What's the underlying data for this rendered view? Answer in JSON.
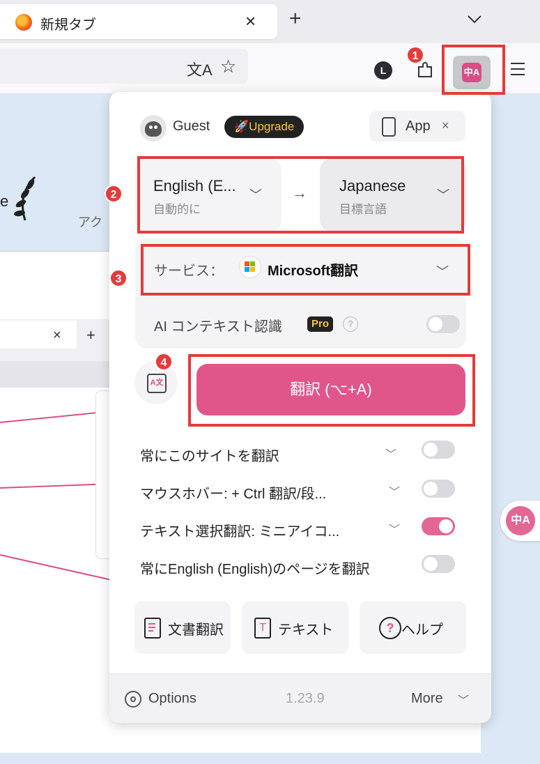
{
  "browser": {
    "tab_title": "新規タブ",
    "tab_close": "×",
    "new_tab": "+",
    "ext_letter": "L",
    "translate_ext_glyph": "中A"
  },
  "page": {
    "partial_text": "e",
    "partial_text2": "アク",
    "inner_tab_close": "×",
    "inner_tab_plus": "+",
    "floating_glyph": "中A"
  },
  "popup": {
    "user": {
      "name": "Guest",
      "upgrade_label": "🚀Upgrade"
    },
    "app_button": {
      "label": "App",
      "close": "×"
    },
    "source_language": {
      "name": "English (E...",
      "sub": "自動的に"
    },
    "arrow": "→",
    "target_language": {
      "name": "Japanese",
      "sub": "目標言語"
    },
    "service": {
      "label": "サービス：",
      "name": "Microsoft翻訳"
    },
    "ai_context": {
      "label": "AI コンテキスト認識",
      "badge": "Pro",
      "help": "?",
      "enabled": false
    },
    "swap_icon_glyph": "A文",
    "translate_button": "翻訳 (⌥+A)",
    "options": [
      {
        "label": "常にこのサイトを翻訳",
        "has_dropdown": true,
        "enabled": false
      },
      {
        "label": "マウスホバー:  + Ctrl 翻訳/段...",
        "has_dropdown": true,
        "enabled": false
      },
      {
        "label": "テキスト選択翻訳:  ミニアイコ...",
        "has_dropdown": true,
        "enabled": true
      },
      {
        "label": "常にEnglish (English)のページを翻訳",
        "has_dropdown": false,
        "enabled": false
      }
    ],
    "bottom_buttons": [
      {
        "label": "文書翻訳",
        "icon": "document-icon"
      },
      {
        "label": "テキスト",
        "icon": "text-icon"
      },
      {
        "label": "ヘルプ",
        "icon": "help-icon"
      }
    ],
    "footer": {
      "options_label": "Options",
      "version": "1.23.9",
      "more_label": "More"
    }
  },
  "annotations": [
    "1",
    "2",
    "3",
    "4"
  ],
  "colors": {
    "accent": "#e0568b",
    "annotation_red": "#e43b3b"
  }
}
